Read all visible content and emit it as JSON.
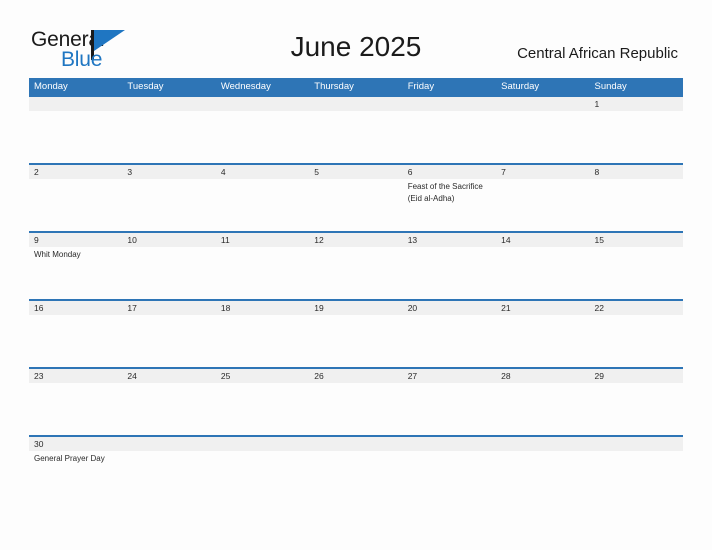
{
  "brand": {
    "name_top": "General",
    "name_bottom": "Blue",
    "accent_color": "#1f76c2"
  },
  "header": {
    "month_title": "June 2025",
    "region": "Central African Republic"
  },
  "calendar": {
    "header_color": "#2e75b6",
    "date_band_color": "#f0f0f0",
    "weekdays": [
      "Monday",
      "Tuesday",
      "Wednesday",
      "Thursday",
      "Friday",
      "Saturday",
      "Sunday"
    ],
    "weeks": [
      {
        "days": [
          {
            "date": "",
            "event": ""
          },
          {
            "date": "",
            "event": ""
          },
          {
            "date": "",
            "event": ""
          },
          {
            "date": "",
            "event": ""
          },
          {
            "date": "",
            "event": ""
          },
          {
            "date": "",
            "event": ""
          },
          {
            "date": "1",
            "event": ""
          }
        ]
      },
      {
        "days": [
          {
            "date": "2",
            "event": ""
          },
          {
            "date": "3",
            "event": ""
          },
          {
            "date": "4",
            "event": ""
          },
          {
            "date": "5",
            "event": ""
          },
          {
            "date": "6",
            "event": "Feast of the Sacrifice (Eid al-Adha)"
          },
          {
            "date": "7",
            "event": ""
          },
          {
            "date": "8",
            "event": ""
          }
        ]
      },
      {
        "days": [
          {
            "date": "9",
            "event": "Whit Monday"
          },
          {
            "date": "10",
            "event": ""
          },
          {
            "date": "11",
            "event": ""
          },
          {
            "date": "12",
            "event": ""
          },
          {
            "date": "13",
            "event": ""
          },
          {
            "date": "14",
            "event": ""
          },
          {
            "date": "15",
            "event": ""
          }
        ]
      },
      {
        "days": [
          {
            "date": "16",
            "event": ""
          },
          {
            "date": "17",
            "event": ""
          },
          {
            "date": "18",
            "event": ""
          },
          {
            "date": "19",
            "event": ""
          },
          {
            "date": "20",
            "event": ""
          },
          {
            "date": "21",
            "event": ""
          },
          {
            "date": "22",
            "event": ""
          }
        ]
      },
      {
        "days": [
          {
            "date": "23",
            "event": ""
          },
          {
            "date": "24",
            "event": ""
          },
          {
            "date": "25",
            "event": ""
          },
          {
            "date": "26",
            "event": ""
          },
          {
            "date": "27",
            "event": ""
          },
          {
            "date": "28",
            "event": ""
          },
          {
            "date": "29",
            "event": ""
          }
        ]
      },
      {
        "days": [
          {
            "date": "30",
            "event": "General Prayer Day"
          },
          {
            "date": "",
            "event": ""
          },
          {
            "date": "",
            "event": ""
          },
          {
            "date": "",
            "event": ""
          },
          {
            "date": "",
            "event": ""
          },
          {
            "date": "",
            "event": ""
          },
          {
            "date": "",
            "event": ""
          }
        ]
      }
    ]
  }
}
